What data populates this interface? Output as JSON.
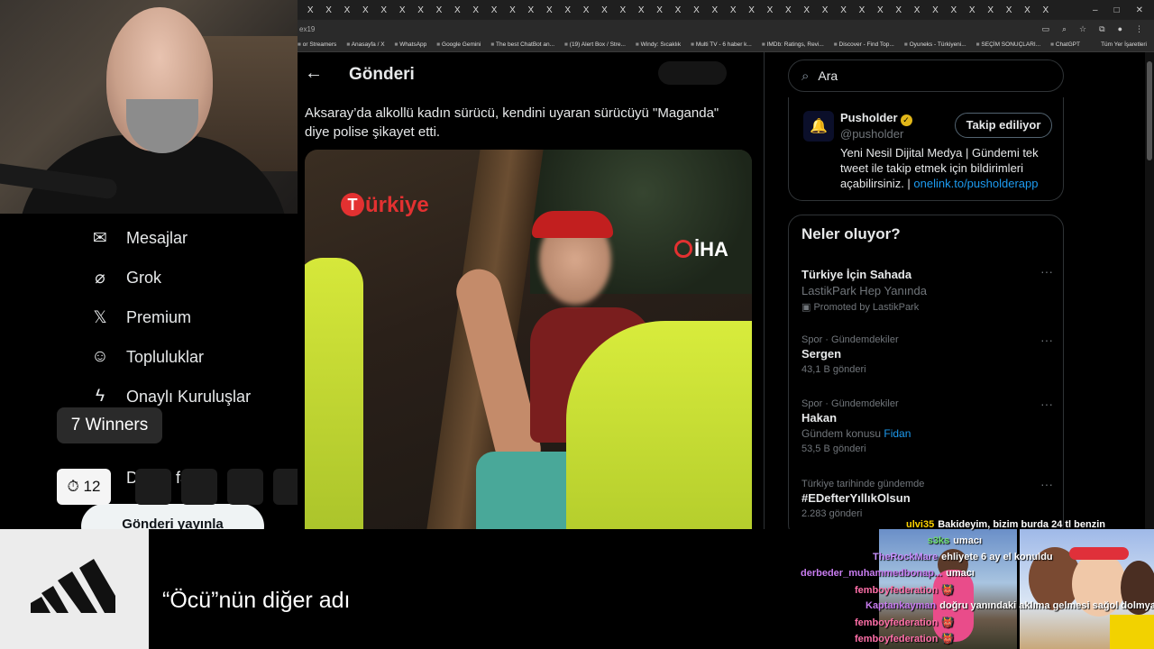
{
  "browser": {
    "tab_glyph": "X",
    "window_controls": [
      "–",
      "□",
      "✕"
    ],
    "address_fragment": "ex19",
    "bookmarks": [
      "or Streamers",
      "Anasayfa / X",
      "WhatsApp",
      "Google Gemini",
      "The best ChatBot an...",
      "(19) Alert Box / Stre...",
      "Windy: Sıcaklık",
      "Multi TV - 6 haber k...",
      "IMDb: Ratings, Revi...",
      "Discover - Find Top...",
      "Oyuneks - Türkiyeni...",
      "SEÇİM SONUÇLARI...",
      "ChatGPT"
    ],
    "all_bookmarks": "Tüm Yer İşaretleri"
  },
  "nav": {
    "items": [
      {
        "label": "Mesajlar",
        "icon": "envelope-icon"
      },
      {
        "label": "Grok",
        "icon": "grok-icon"
      },
      {
        "label": "Premium",
        "icon": "x-logo-icon"
      },
      {
        "label": "Topluluklar",
        "icon": "communities-icon"
      },
      {
        "label": "Onaylı Kuruluşlar",
        "icon": "lightning-icon"
      },
      {
        "label": "l",
        "icon": "profile-icon"
      },
      {
        "label": "D",
        "icon": "more-icon"
      }
    ],
    "post_button": "Gönderi yayınla",
    "partial_text": "fa"
  },
  "overlay": {
    "winners": "7 Winners",
    "timer": "⏱ 12"
  },
  "post": {
    "header": "Gönderi",
    "text": "Aksaray’da alkollü kadın sürücü, kendini uyaran sürücüyü \"Maganda\" diye polise şikayet etti.",
    "watermark_left": "ürkiye",
    "watermark_left_t": "T",
    "watermark_right": "İHA"
  },
  "sidebar": {
    "search_placeholder": "Ara",
    "account": {
      "name": "Pusholder",
      "handle": "@pusholder",
      "follow_button": "Takip ediliyor",
      "bio": "Yeni Nesil Dijital Medya | Gündemi tek tweet ile takip etmek için bildirimleri açabilirsiniz. |",
      "link": "onelink.to/pusholderapp"
    },
    "trends_header": "Neler oluyor?",
    "trends": [
      {
        "meta": "",
        "name": "Türkiye İçin Sahada",
        "sub": "LastikPark Hep Yanında",
        "count": "▣ Promoted by LastikPark"
      },
      {
        "meta": "Spor · Gündemdekiler",
        "name": "Sergen",
        "sub": "",
        "count": "43,1 B gönderi"
      },
      {
        "meta": "Spor · Gündemdekiler",
        "name": "Hakan",
        "sub": "Gündem konusu ",
        "sub_link": "Fidan",
        "count": "53,5 B gönderi"
      },
      {
        "meta": "Türkiye tarihinde gündemde",
        "name": "#EDefterYıllıkOlsun",
        "sub": "",
        "count": "2.283 gönderi"
      }
    ]
  },
  "banner": {
    "text": "“Öcü”nün diğer adı"
  },
  "chat": [
    {
      "nick": "ulvi35",
      "msg": "Bakideyim, bizim burda 24 tl benzin"
    },
    {
      "nick": "s3ks",
      "msg": "umacı"
    },
    {
      "nick": "TheRockMare",
      "msg": "ehliyete 6 ay el konuldu"
    },
    {
      "nick": "derbeder_muhammedbonap...",
      "msg": "umacı"
    },
    {
      "nick": "femboyfederation",
      "msg": "👹"
    },
    {
      "nick": "Kaptankayman",
      "msg": "doğru yanındaki aklıma gelmesi sağol dolmya"
    },
    {
      "nick": "femboyfederation",
      "msg": "👹"
    },
    {
      "nick": "femboyfederation",
      "msg": "👹"
    }
  ]
}
